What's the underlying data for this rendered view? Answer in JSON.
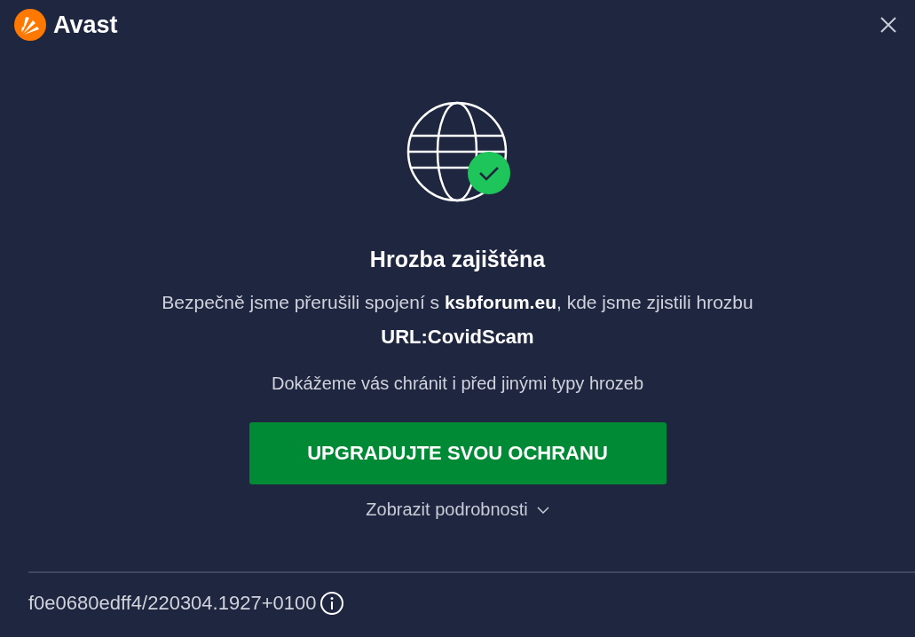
{
  "app": {
    "name": "Avast"
  },
  "title": "Hrozba zajištěna",
  "message": "Bezpečně jsme přerušili spojení s **ksbforum.eu**, kde jsme zjistili hrozbu",
  "threat": "URL:CovidScam",
  "subtext": "Dokážeme vás chránit i před jinými typy hrozeb",
  "button": "UPGRADUJTE SVOU OCHRANU",
  "details": {
    "label": "Zobrazit podrobnosti",
    "expanded": false
  },
  "footer": "f0e0680edff4/220304.1927+0100"
}
